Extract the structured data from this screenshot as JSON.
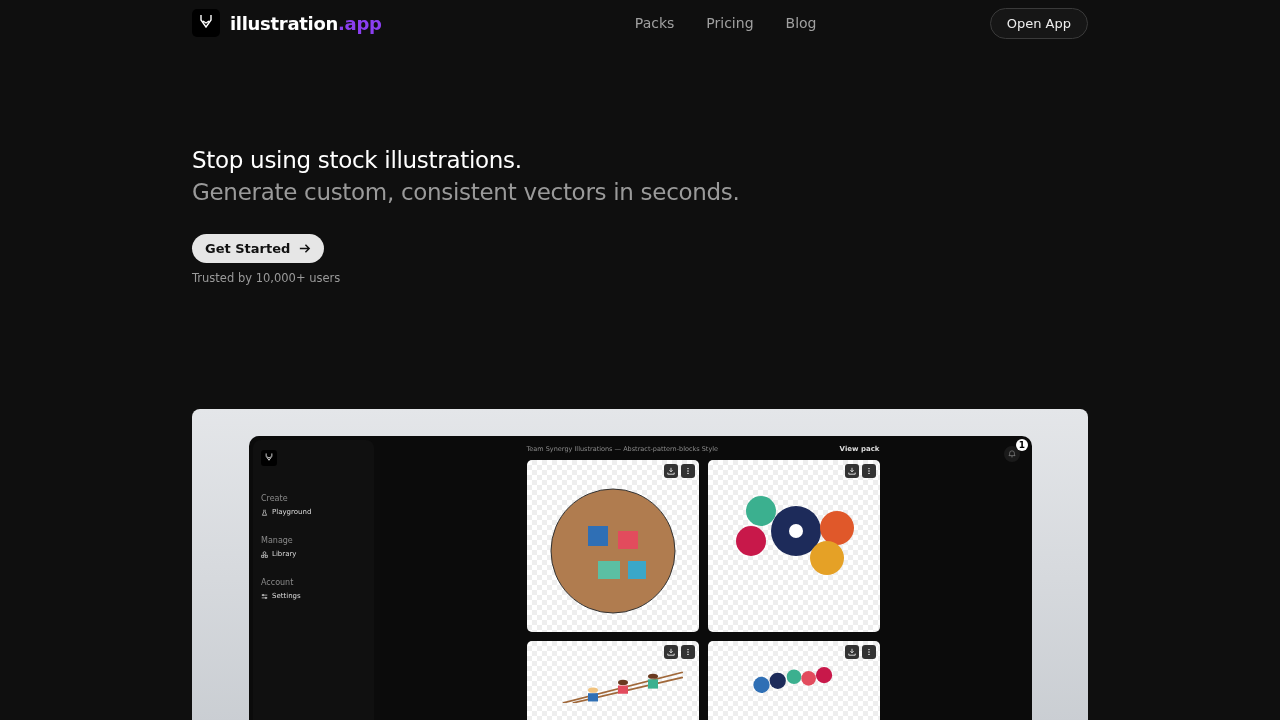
{
  "brand": {
    "name": "illustration",
    "suffix": ".app"
  },
  "nav": {
    "links": [
      "Packs",
      "Pricing",
      "Blog"
    ],
    "cta": "Open App"
  },
  "hero": {
    "title": "Stop using stock illustrations.",
    "subtitle": "Generate custom, consistent vectors in seconds.",
    "button": "Get Started",
    "note": "Trusted by 10,000+ users"
  },
  "preview": {
    "sidebar": [
      {
        "section": "Create",
        "item": "Playground",
        "kind": "flask"
      },
      {
        "section": "Manage",
        "item": "Library",
        "kind": "shapes"
      },
      {
        "section": "Account",
        "item": "Settings",
        "kind": "sliders"
      }
    ],
    "header": "Team Synergy Illustrations — Abstract-pattern-blocks Style",
    "view": "View pack",
    "badge": "1",
    "cards": [
      {
        "kind": "puzzle"
      },
      {
        "kind": "gears"
      },
      {
        "kind": "ladder"
      },
      {
        "kind": "bubbles"
      }
    ]
  }
}
